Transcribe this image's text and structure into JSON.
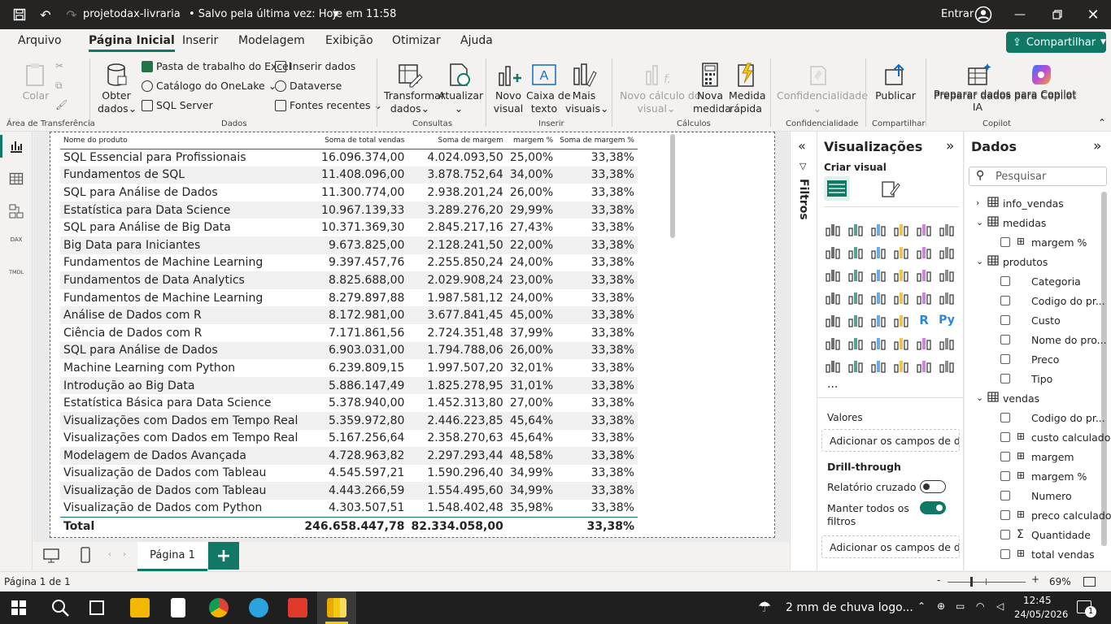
{
  "titlebar": {
    "title": "projetodax-livraria",
    "saved": "• Salvo pela última vez: Hoje em 11:58",
    "login": "Entrar"
  },
  "tabs": [
    "Arquivo",
    "Página Inicial",
    "Inserir",
    "Modelagem",
    "Exibição",
    "Otimizar",
    "Ajuda"
  ],
  "share_label": "Compartilhar",
  "ribbon": {
    "clipboard": {
      "colar": "Colar",
      "group": "Área de Transferência"
    },
    "dados": {
      "obter1": "Obter",
      "obter2": "dados",
      "excel": "Pasta de trabalho do Excel",
      "onelake": "Catálogo do OneLake",
      "sql": "SQL Server",
      "inserir": "Inserir dados",
      "dataverse": "Dataverse",
      "fontes": "Fontes recentes",
      "group": "Dados"
    },
    "consultas": {
      "transformar1": "Transformar",
      "transformar2": "dados",
      "atualizar": "Atualizar",
      "group": "Consultas"
    },
    "inserir": {
      "novo1": "Novo",
      "novo2": "visual",
      "caixa1": "Caixa de",
      "caixa2": "texto",
      "mais1": "Mais",
      "mais2": "visuais",
      "group": "Inserir"
    },
    "calculos": {
      "novocalc1": "Novo cálculo do",
      "novocalc2": "visual",
      "nova1": "Nova",
      "nova2": "medida",
      "medida1": "Medida",
      "medida2": "rápida",
      "group": "Cálculos"
    },
    "conf": {
      "label": "Confidencialidade",
      "group": "Confidencialidade"
    },
    "compartilhar": {
      "publicar": "Publicar",
      "group": "Compartilhar"
    },
    "copilot": {
      "label1": "Preparar dados para Copilot",
      "label2": "IA",
      "group": "Copilot"
    }
  },
  "table": {
    "headers": [
      "Nome do produto",
      "Soma de total vendas",
      "Soma de margem",
      "margem %",
      "Soma de margem %"
    ],
    "rows": [
      [
        "SQL Essencial para Profissionais",
        "16.096.374,00",
        "4.024.093,50",
        "25,00%",
        "33,38%"
      ],
      [
        "Fundamentos de SQL",
        "11.408.096,00",
        "3.878.752,64",
        "34,00%",
        "33,38%"
      ],
      [
        "SQL para Análise de Dados",
        "11.300.774,00",
        "2.938.201,24",
        "26,00%",
        "33,38%"
      ],
      [
        "Estatística para Data Science",
        "10.967.139,33",
        "3.289.276,20",
        "29,99%",
        "33,38%"
      ],
      [
        "SQL para Análise de Big Data",
        "10.371.369,30",
        "2.845.217,16",
        "27,43%",
        "33,38%"
      ],
      [
        "Big Data para Iniciantes",
        "9.673.825,00",
        "2.128.241,50",
        "22,00%",
        "33,38%"
      ],
      [
        "Fundamentos de Machine Learning",
        "9.397.457,76",
        "2.255.850,24",
        "24,00%",
        "33,38%"
      ],
      [
        "Fundamentos de Data Analytics",
        "8.825.688,00",
        "2.029.908,24",
        "23,00%",
        "33,38%"
      ],
      [
        "Fundamentos de Machine Learning",
        "8.279.897,88",
        "1.987.581,12",
        "24,00%",
        "33,38%"
      ],
      [
        "Análise de Dados com R",
        "8.172.981,00",
        "3.677.841,45",
        "45,00%",
        "33,38%"
      ],
      [
        "Ciência de Dados com R",
        "7.171.861,56",
        "2.724.351,48",
        "37,99%",
        "33,38%"
      ],
      [
        "SQL para Análise de Dados",
        "6.903.031,00",
        "1.794.788,06",
        "26,00%",
        "33,38%"
      ],
      [
        "Machine Learning com Python",
        "6.239.809,15",
        "1.997.507,20",
        "32,01%",
        "33,38%"
      ],
      [
        "Introdução ao Big Data",
        "5.886.147,49",
        "1.825.278,95",
        "31,01%",
        "33,38%"
      ],
      [
        "Estatística Básica para Data Science",
        "5.378.940,00",
        "1.452.313,80",
        "27,00%",
        "33,38%"
      ],
      [
        "Visualizações com Dados em Tempo Real",
        "5.359.972,80",
        "2.446.223,85",
        "45,64%",
        "33,38%"
      ],
      [
        "Visualizações com Dados em Tempo Real",
        "5.167.256,64",
        "2.358.270,63",
        "45,64%",
        "33,38%"
      ],
      [
        "Modelagem de Dados Avançada",
        "4.728.963,82",
        "2.297.293,44",
        "48,58%",
        "33,38%"
      ],
      [
        "Visualização de Dados com Tableau",
        "4.545.597,21",
        "1.590.296,40",
        "34,99%",
        "33,38%"
      ],
      [
        "Visualização de Dados com Tableau",
        "4.443.266,59",
        "1.554.495,60",
        "34,99%",
        "33,38%"
      ],
      [
        "Visualização de Dados com Python",
        "4.303.507,51",
        "1.548.402,48",
        "35,98%",
        "33,38%"
      ]
    ],
    "total": [
      "Total",
      "246.658.447,78",
      "82.334.058,00",
      "",
      "33,38%"
    ]
  },
  "page_tab": "Página 1",
  "filters_label": "Filtros",
  "viz": {
    "title": "Visualizações",
    "criar": "Criar visual",
    "valores": "Valores",
    "valores_field": "Adicionar os campos de da...",
    "drill": "Drill-through",
    "cruzado": "Relatório cruzado",
    "manter1": "Manter todos os",
    "manter2": "filtros",
    "drill_field": "Adicionar os campos de dr...",
    "r_label": "R",
    "py_label": "Py",
    "more": "..."
  },
  "dados": {
    "title": "Dados",
    "search_placeholder": "Pesquisar",
    "items": [
      {
        "label": "info_vendas",
        "kind": "table",
        "level": 0,
        "expanded": false
      },
      {
        "label": "medidas",
        "kind": "table",
        "level": 0,
        "expanded": true
      },
      {
        "label": "margem %",
        "kind": "measure",
        "level": 1
      },
      {
        "label": "produtos",
        "kind": "table",
        "level": 0,
        "expanded": true
      },
      {
        "label": "Categoria",
        "kind": "field",
        "level": 1
      },
      {
        "label": "Codigo do pr...",
        "kind": "field",
        "level": 1
      },
      {
        "label": "Custo",
        "kind": "field",
        "level": 1
      },
      {
        "label": "Nome do pro...",
        "kind": "field",
        "level": 1
      },
      {
        "label": "Preco",
        "kind": "field",
        "level": 1
      },
      {
        "label": "Tipo",
        "kind": "field",
        "level": 1
      },
      {
        "label": "vendas",
        "kind": "table",
        "level": 0,
        "expanded": true
      },
      {
        "label": "Codigo do pr...",
        "kind": "field",
        "level": 1
      },
      {
        "label": "custo calculado",
        "kind": "measure",
        "level": 1
      },
      {
        "label": "margem",
        "kind": "measure",
        "level": 1
      },
      {
        "label": "margem %",
        "kind": "measure",
        "level": 1
      },
      {
        "label": "Numero",
        "kind": "field",
        "level": 1
      },
      {
        "label": "preco calculado",
        "kind": "measure",
        "level": 1
      },
      {
        "label": "Quantidade",
        "kind": "sum",
        "level": 1
      },
      {
        "label": "total vendas",
        "kind": "measure",
        "level": 1
      }
    ]
  },
  "status": {
    "page": "Página 1 de 1",
    "zoom": "69%"
  },
  "taskbar": {
    "weather": "2 mm de chuva logo...",
    "time": "12:45",
    "date": "24/05/2026",
    "badge": "1"
  }
}
